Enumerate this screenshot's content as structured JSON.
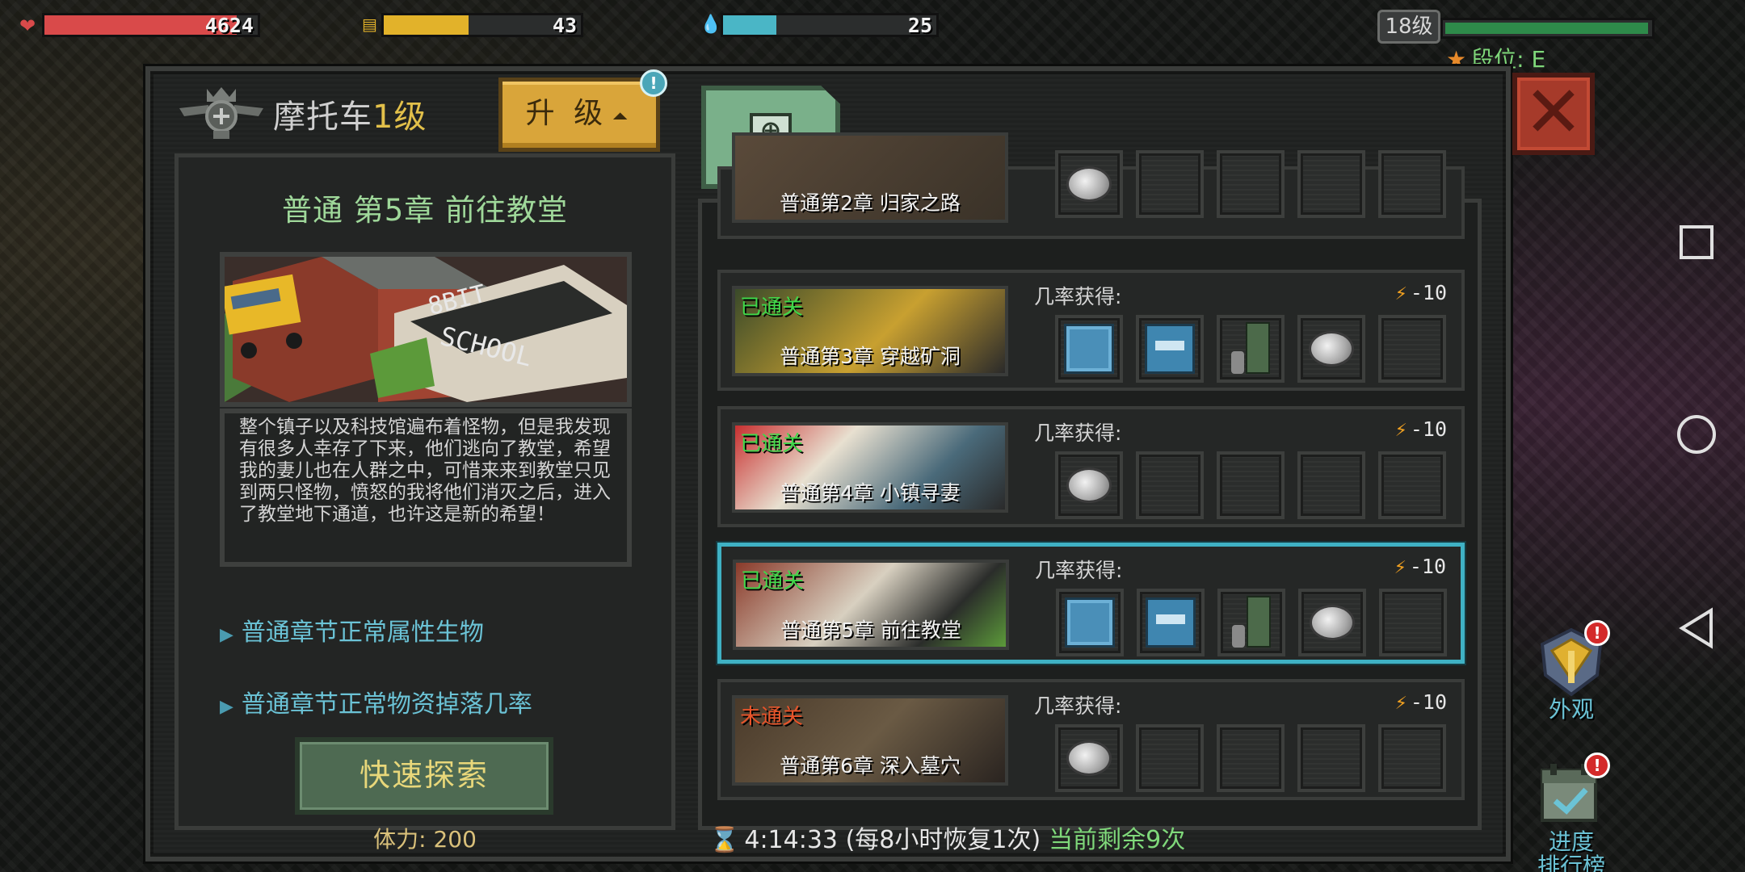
{
  "hud": {
    "health": {
      "value": "4624",
      "fraction": 0.9,
      "color": "#d94a4a"
    },
    "food": {
      "value": "43",
      "fraction": 0.43,
      "color": "#e2b22a"
    },
    "water": {
      "value": "25",
      "fraction": 0.25,
      "color": "#4ab6c6"
    },
    "level": "18级",
    "xp_fraction": 0.97,
    "rank": "段位: E"
  },
  "panel": {
    "vehicle_name": "摩托车",
    "vehicle_level": "1级",
    "upgrade_label": "升 级",
    "info_icon": "!",
    "close_icon": "close-x"
  },
  "chapter_detail": {
    "title": "普通 第5章 前往教堂",
    "description": "整个镇子以及科技馆遍布着怪物，但是我发现有很多人幸存了下来，他们逃向了教堂，希望我的妻儿也在人群之中，可惜来来到教堂只见到两只怪物，愤怒的我将他们消灭之后，进入了教堂地下通道，也许这是新的希望！",
    "link_1": "普通章节正常属性生物",
    "link_2": "普通章节正常物资掉落几率",
    "quick_explore": "快速探索",
    "stamina": "体力: 200"
  },
  "chapters": [
    {
      "name": "普通第2章 归家之路",
      "status": "",
      "chance_label": "",
      "cost": "",
      "slots": [
        "coin",
        "",
        "",
        "",
        ""
      ]
    },
    {
      "name": "普通第3章 穿越矿洞",
      "status": "已通关",
      "chance_label": "几率获得:",
      "cost": "-10",
      "slots": [
        "armor",
        "gun",
        "parts",
        "coin",
        ""
      ]
    },
    {
      "name": "普通第4章 小镇寻妻",
      "status": "已通关",
      "chance_label": "几率获得:",
      "cost": "-10",
      "slots": [
        "coin",
        "",
        "",
        "",
        ""
      ]
    },
    {
      "name": "普通第5章 前往教堂",
      "status": "已通关",
      "chance_label": "几率获得:",
      "cost": "-10",
      "slots": [
        "armor",
        "gun",
        "parts",
        "coin",
        ""
      ]
    },
    {
      "name": "普通第6章 深入墓穴",
      "status": "未通关",
      "chance_label": "几率获得:",
      "cost": "-10",
      "slots": [
        "coin",
        "",
        "",
        "",
        ""
      ]
    }
  ],
  "timer": {
    "time": "4:14:33",
    "recover": "(每8小时恢复1次)",
    "remaining": "当前剩余9次"
  },
  "side": {
    "appearance": "外观",
    "leaderboard_line1": "进度",
    "leaderboard_line2": "排行榜",
    "badge": "!"
  },
  "colors": {
    "cleared": "#3fd84a",
    "not_cleared": "#e8542a",
    "selected_border": "#3fb1c4"
  }
}
